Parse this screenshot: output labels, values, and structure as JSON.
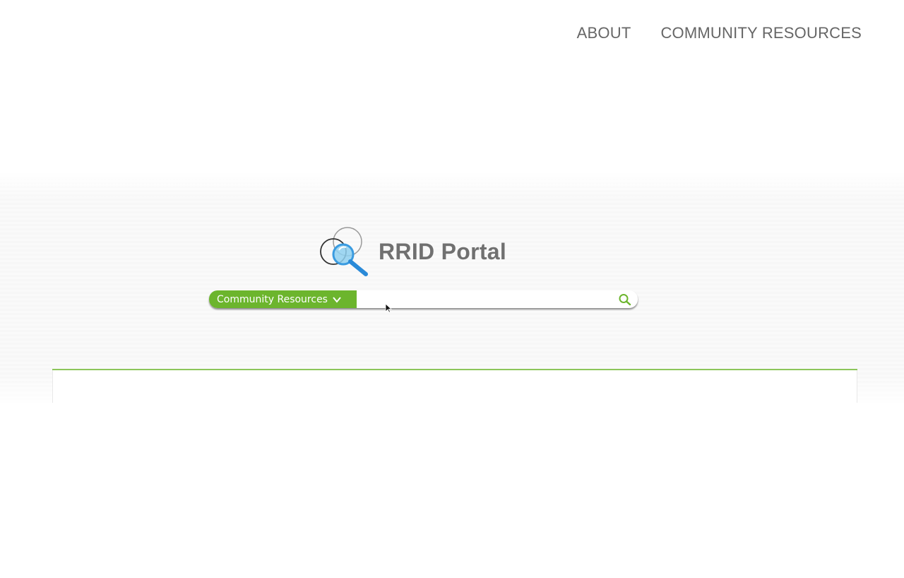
{
  "nav": {
    "items": [
      {
        "label": "ABOUT"
      },
      {
        "label": "COMMUNITY RESOURCES"
      }
    ]
  },
  "logo": {
    "text": "RRID Portal",
    "icon": "magnifier-over-circles-icon"
  },
  "search": {
    "category_label": "Community Resources",
    "category_icon": "chevron-down-icon",
    "input_value": "",
    "submit_icon": "search-icon"
  },
  "colors": {
    "accent_green": "#6cb52d",
    "nav_text": "#666666",
    "divider": "#8cc65a"
  }
}
